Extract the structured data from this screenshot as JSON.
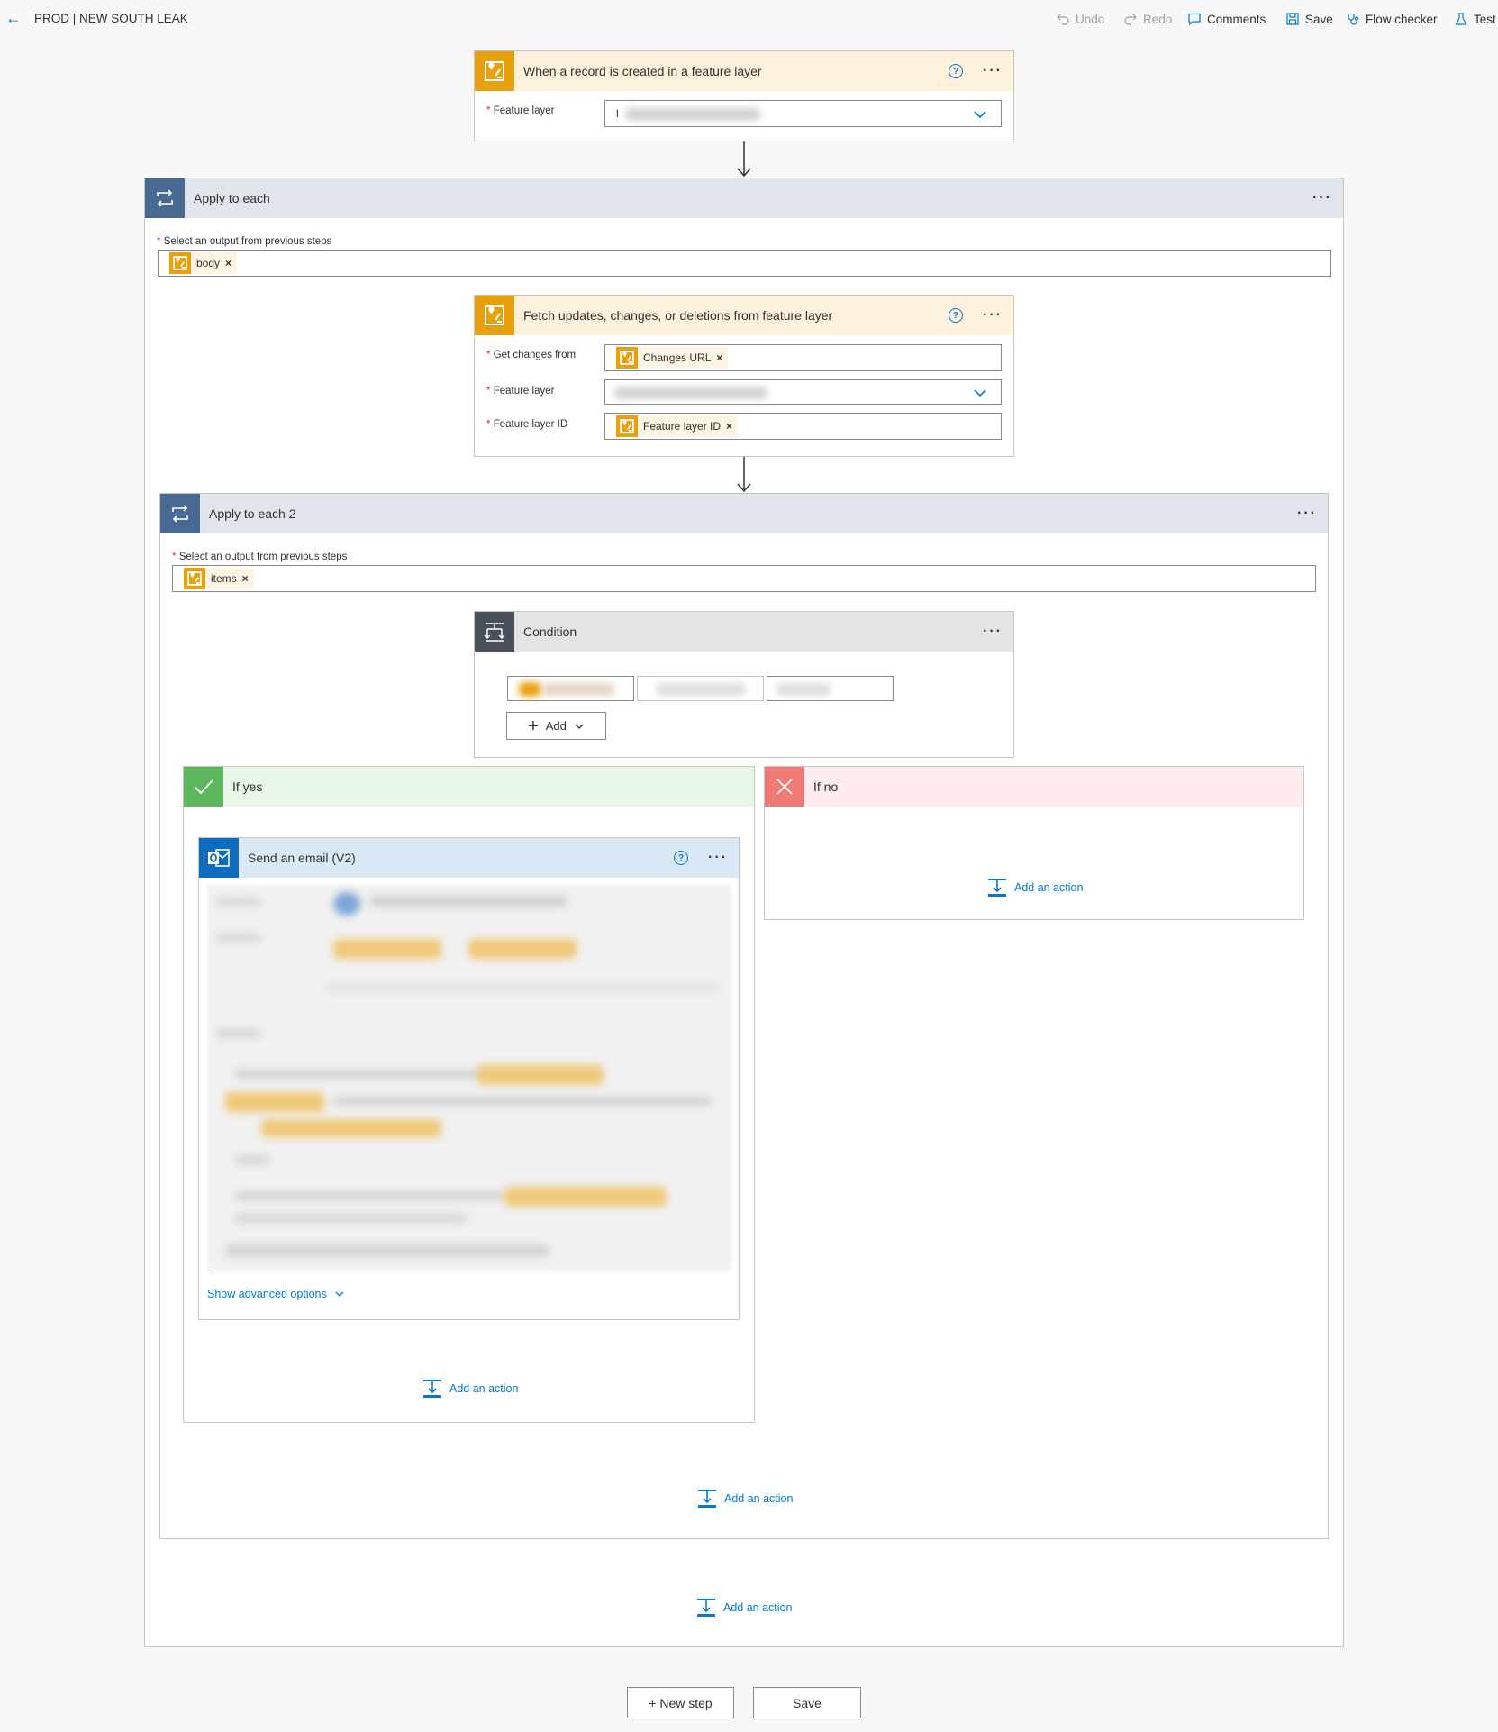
{
  "header": {
    "title": "PROD | NEW SOUTH LEAK",
    "undo": "Undo",
    "redo": "Redo",
    "comments": "Comments",
    "save": "Save",
    "flow_checker": "Flow checker",
    "test": "Test"
  },
  "trigger": {
    "title": "When a record is created in a feature layer",
    "field_label": "Feature layer",
    "field_value_prefix": "l"
  },
  "apply_each": {
    "title": "Apply to each",
    "field_label": "Select an output from previous steps",
    "token": "body"
  },
  "fetch": {
    "title": "Fetch updates, changes, or deletions from feature layer",
    "get_changes_label": "Get changes from",
    "get_changes_token": "Changes URL",
    "feature_layer_label": "Feature layer",
    "feature_layer_id_label": "Feature layer ID",
    "feature_layer_id_token": "Feature layer ID"
  },
  "apply_each_2": {
    "title": "Apply to each 2",
    "field_label": "Select an output from previous steps",
    "token": "items"
  },
  "condition": {
    "title": "Condition",
    "add_label": "Add"
  },
  "if_yes": {
    "title": "If yes",
    "add_action": "Add an action"
  },
  "if_no": {
    "title": "If no",
    "add_action": "Add an action"
  },
  "email": {
    "title": "Send an email (V2)",
    "advanced": "Show advanced options"
  },
  "loop2_add_action": "Add an action",
  "loop1_add_action": "Add an action",
  "footer": {
    "new_step": "+ New step",
    "save": "Save"
  },
  "colors": {
    "accent": "#0078d4",
    "arcgis": "#e8a00c",
    "loop": "#486991",
    "condition": "#484f58",
    "yes": "#5cb85c",
    "no": "#ef7b76",
    "outlook": "#0f6cbd"
  }
}
